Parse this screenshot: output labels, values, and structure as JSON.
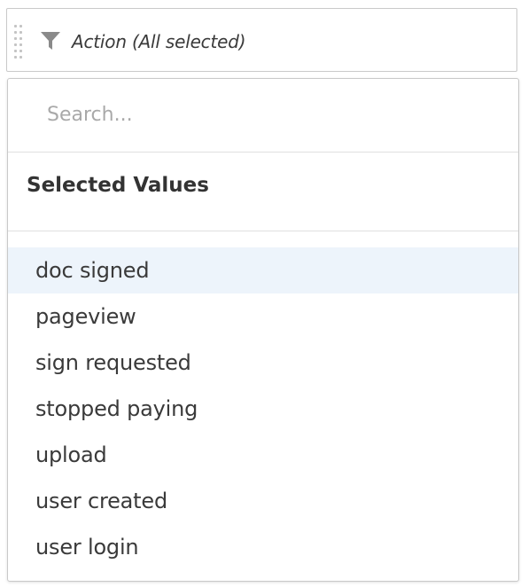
{
  "filter": {
    "title": "Action (All selected)",
    "icon": "funnel-icon",
    "drag_icon": "drag-handle-icon"
  },
  "search": {
    "placeholder": "Search..."
  },
  "selected_section": {
    "header": "Selected Values"
  },
  "values": [
    "doc signed",
    "pageview",
    "sign requested",
    "stopped paying",
    "upload",
    "user created",
    "user login"
  ],
  "highlighted_index": 0,
  "colors": {
    "highlight": "#edf4fb",
    "border": "#c9c9c9",
    "text": "#3a3a3a",
    "placeholder": "#a9a9a9",
    "icon": "#8a8a8a"
  }
}
